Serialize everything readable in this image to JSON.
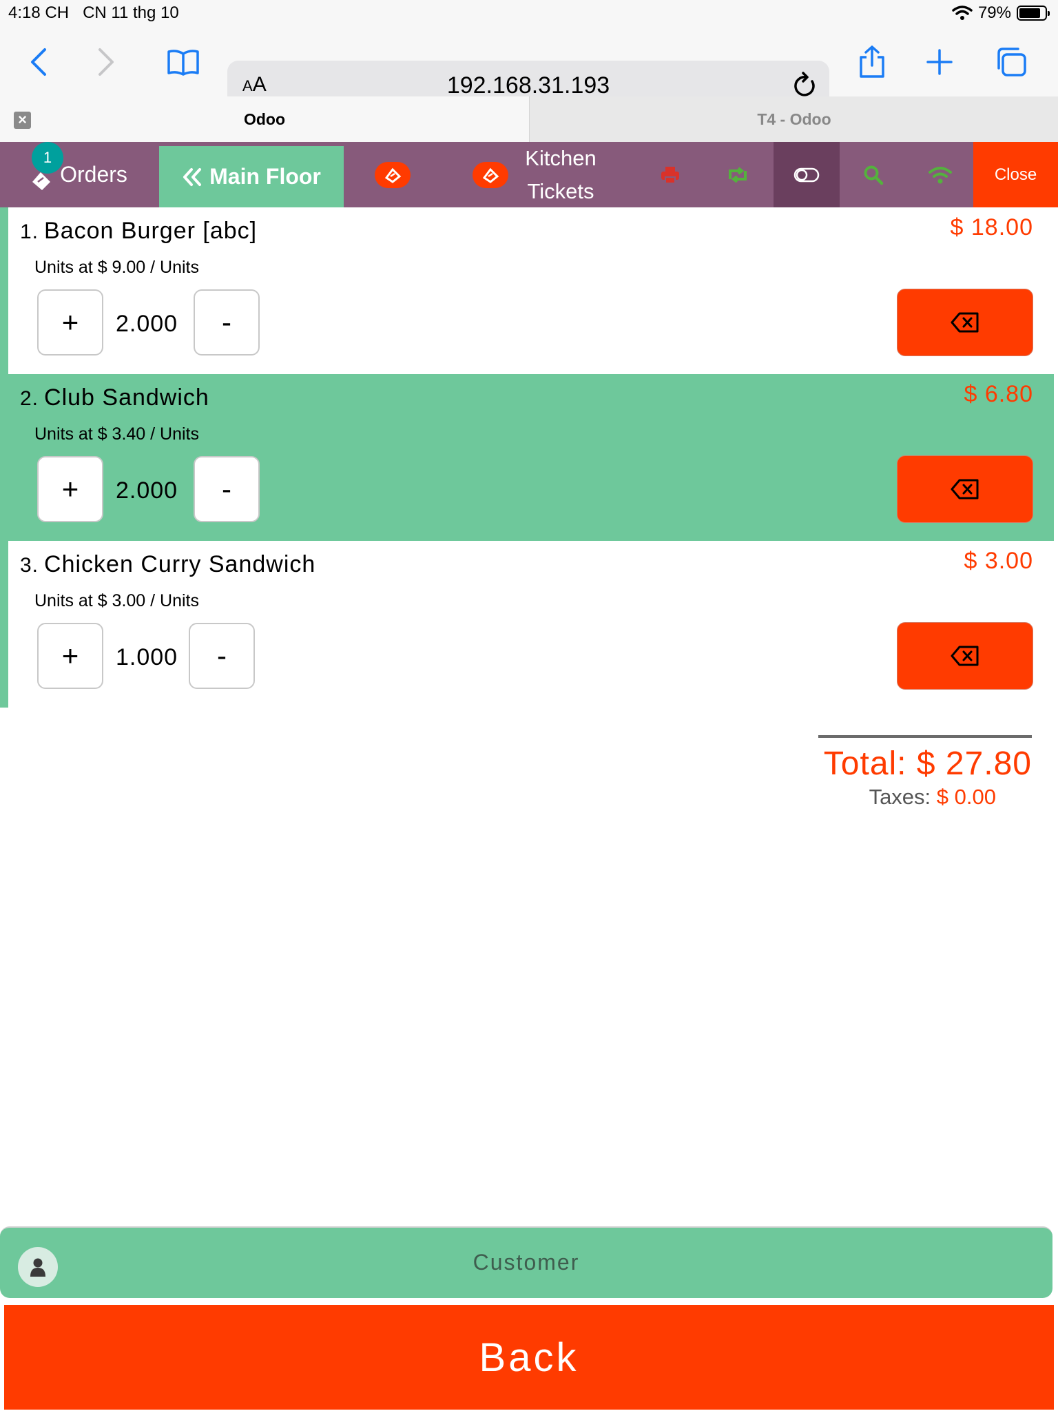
{
  "status_bar": {
    "time": "4:18 CH",
    "date": "CN 11 thg 10",
    "battery": "79%",
    "battery_level": 0.79
  },
  "browser": {
    "text_size_label": "AA",
    "url": "192.168.31.193",
    "tabs": [
      {
        "label": "Odoo",
        "active": true
      },
      {
        "label": "T4 - Odoo",
        "active": false
      }
    ]
  },
  "pos_header": {
    "orders_label": "Orders",
    "orders_count": "1",
    "floor_label": "Main Floor",
    "kitchen_label_line1": "Kitchen",
    "kitchen_label_line2": "Tickets",
    "close_label": "Close"
  },
  "order_lines": [
    {
      "number": "1.",
      "name": "Bacon Burger [abc]",
      "price": "$ 18.00",
      "unit_info": "Units at $ 9.00 / Units",
      "qty": "2.000",
      "selected": false
    },
    {
      "number": "2.",
      "name": "Club Sandwich",
      "price": "$ 6.80",
      "unit_info": "Units at $ 3.40 / Units",
      "qty": "2.000",
      "selected": true
    },
    {
      "number": "3.",
      "name": "Chicken Curry Sandwich",
      "price": "$ 3.00",
      "unit_info": "Units at $ 3.00 / Units",
      "qty": "1.000",
      "selected": false
    }
  ],
  "qty_controls": {
    "plus": "+",
    "minus": "-"
  },
  "totals": {
    "total_label": "Total: $ 27.80",
    "taxes_label": "Taxes:",
    "taxes_value": "$ 0.00"
  },
  "customer_label": "Customer",
  "back_label": "Back",
  "colors": {
    "pos_purple": "#875a7b",
    "accent_green": "#6ec89b",
    "accent_red": "#ff3b00"
  }
}
